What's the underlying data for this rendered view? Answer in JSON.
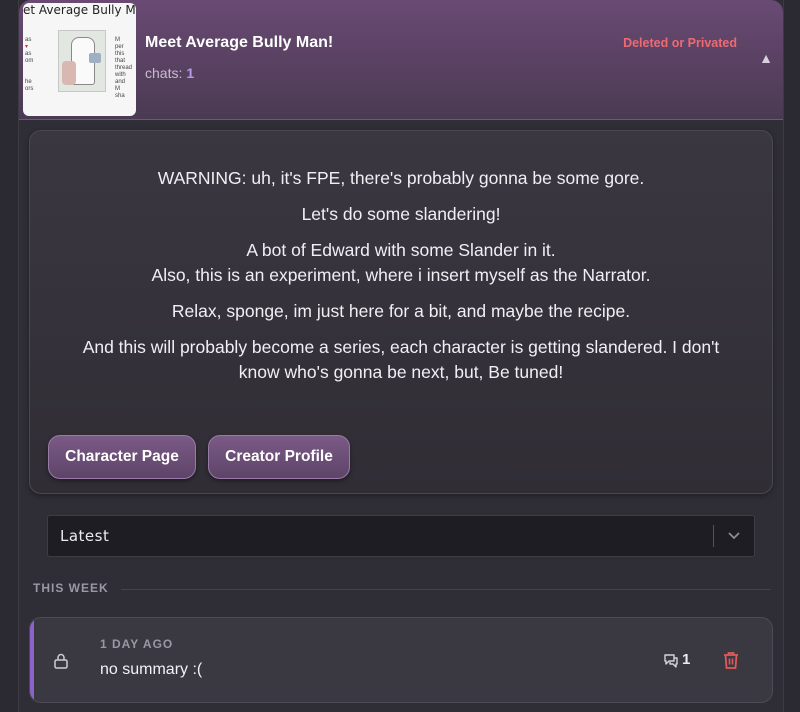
{
  "character": {
    "thumbnail_title": "et Average Bully M",
    "name": "Meet Average Bully Man!",
    "chats_label": "chats:",
    "chats_count": "1",
    "status": "Deleted or Privated",
    "collapse_icon": "triangle-up-icon"
  },
  "description": [
    "WARNING: uh, it's FPE, there's probably gonna be some gore.",
    "Let's do some slandering!",
    "A bot of Edward with some Slander in it.\nAlso, this is an experiment, where i insert myself as the Narrator.",
    "Relax, sponge, im just here for a bit, and maybe the recipe.",
    "And this will probably become a series, each character is getting slandered. I don't know who's gonna be next, but, Be tuned!"
  ],
  "buttons": {
    "character_page": "Character Page",
    "creator_profile": "Creator Profile"
  },
  "sort": {
    "selected": "Latest"
  },
  "section": {
    "label": "THIS WEEK"
  },
  "chats": [
    {
      "when": "1 DAY AGO",
      "summary": "no summary :(",
      "message_count": "1"
    }
  ],
  "colors": {
    "accent": "#8a63c8",
    "status": "#ee6a72",
    "header": "#6a4a74",
    "delete": "#e05a5a"
  }
}
